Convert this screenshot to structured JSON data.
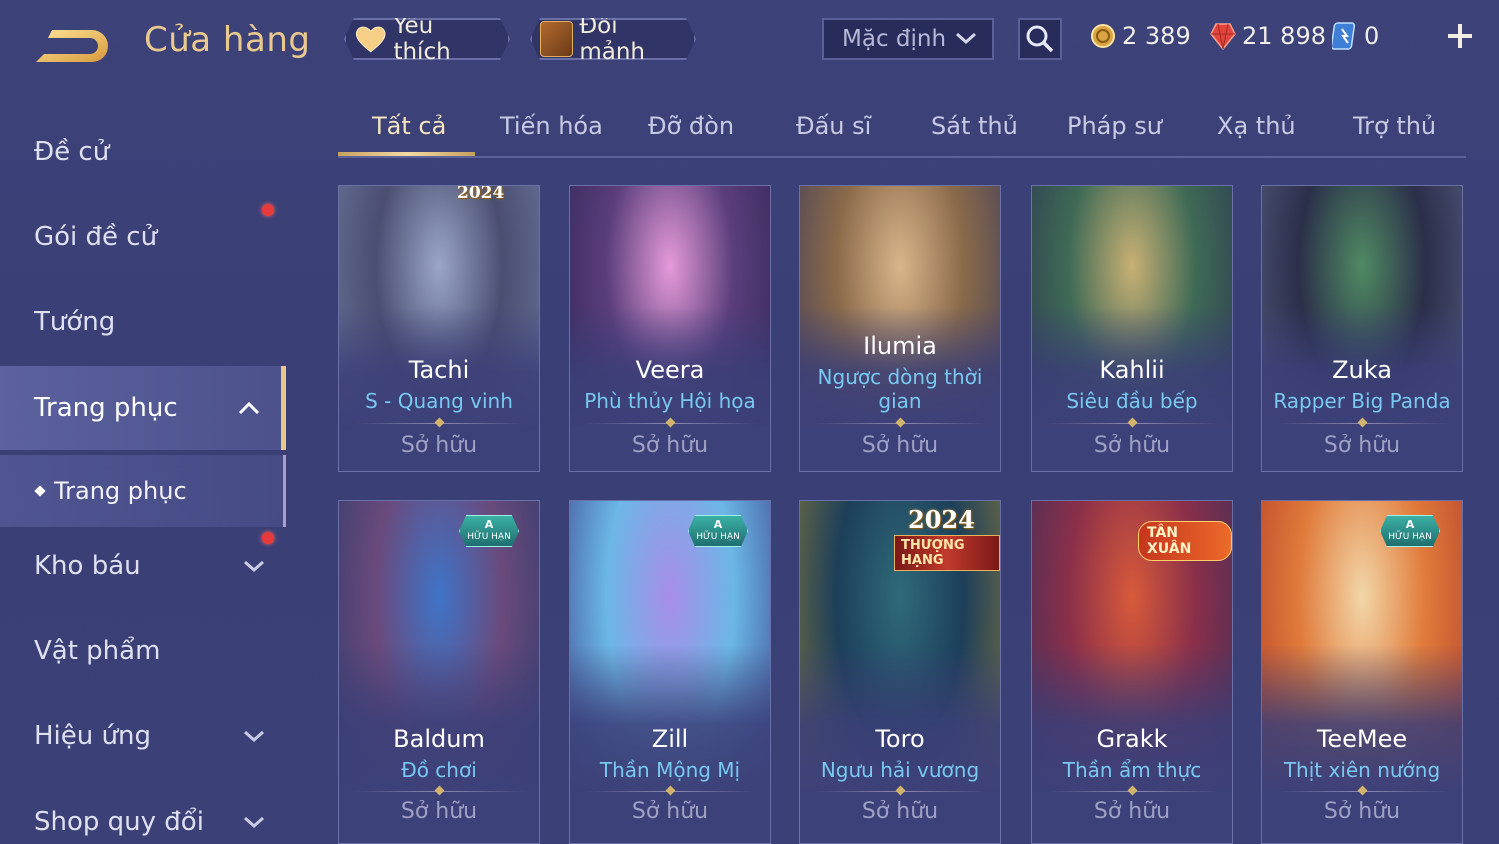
{
  "header": {
    "title": "Cửa hàng",
    "favorite_label": "Yêu thích",
    "fragment_label": "Đổi mảnh",
    "sort_selected": "Mặc định",
    "currencies": {
      "gold": "2 389",
      "ruby": "21 898",
      "voucher": "0"
    }
  },
  "sidebar": {
    "items": [
      {
        "label": "Đề cử"
      },
      {
        "label": "Gói đề cử"
      },
      {
        "label": "Tướng"
      },
      {
        "label": "Trang phục"
      },
      {
        "label": "Kho báu"
      },
      {
        "label": "Vật phẩm"
      },
      {
        "label": "Hiệu ứng"
      },
      {
        "label": "Shop quy đổi"
      }
    ],
    "sub_item": "Trang phục"
  },
  "tabs": [
    "Tất cả",
    "Tiến hóa",
    "Đỡ đòn",
    "Đấu sĩ",
    "Sát thủ",
    "Pháp sư",
    "Xạ thủ",
    "Trợ thủ"
  ],
  "cards": [
    {
      "hero": "Tachi",
      "skin": "S - Quang vinh",
      "status": "Sở hữu",
      "badge_year": "2024",
      "colors": [
        "#9aa6c7",
        "#4a4f72",
        "#6f7aa0"
      ]
    },
    {
      "hero": "Veera",
      "skin": "Phù thủy Hội họa",
      "status": "Sở hữu",
      "colors": [
        "#e59ad8",
        "#5b3e7c",
        "#2c2452"
      ]
    },
    {
      "hero": "Ilumia",
      "skin_line1": "Ngược dòng thời",
      "skin_line2": "gian",
      "status": "Sở hữu",
      "colors": [
        "#d9b58a",
        "#8a6a4a",
        "#3d3a5c"
      ]
    },
    {
      "hero": "Kahlii",
      "skin": "Siêu đầu bếp",
      "status": "Sở hữu",
      "colors": [
        "#c8b074",
        "#3f6a56",
        "#2a3350"
      ]
    },
    {
      "hero": "Zuka",
      "skin": "Rapper Big Panda",
      "status": "Sở hữu",
      "colors": [
        "#4f8a62",
        "#2b2f4a",
        "#5a5f86"
      ]
    },
    {
      "hero": "Baldum",
      "skin": "Đồ chơi",
      "status": "Sở hữu",
      "badge_ltd": "HỮU HẠN",
      "badge_ltd_top": "A",
      "colors": [
        "#3f74c7",
        "#6a4a7c",
        "#2a3a6a"
      ]
    },
    {
      "hero": "Zill",
      "skin": "Thần Mộng Mị",
      "status": "Sở hữu",
      "badge_ltd": "HỮU HẠN",
      "badge_ltd_top": "A",
      "colors": [
        "#a88de8",
        "#6bb7e6",
        "#3b3f88"
      ]
    },
    {
      "hero": "Toro",
      "skin": "Ngưu hải vương",
      "status": "Sở hữu",
      "badge_year": "2024",
      "badge_rank": "THƯỢNG HẠNG",
      "colors": [
        "#2f6a7a",
        "#1d3f5a",
        "#8a7a3a"
      ]
    },
    {
      "hero": "Grakk",
      "skin": "Thần ẩm thực",
      "status": "Sở hữu",
      "badge_spring": "TÂN XUÂN",
      "colors": [
        "#d85a3a",
        "#8a2f4a",
        "#3a2f5a"
      ]
    },
    {
      "hero": "TeeMee",
      "skin": "Thịt xiên nướng",
      "status": "Sở hữu",
      "badge_ltd": "HỮU HẠN",
      "badge_ltd_top": "A",
      "colors": [
        "#f2d6a8",
        "#e07a3a",
        "#b23a2a"
      ]
    }
  ],
  "theme": {
    "accent_gold": "#e9c98e",
    "skin_name_blue": "#78c8f2",
    "alert_red": "#e83a3a"
  }
}
